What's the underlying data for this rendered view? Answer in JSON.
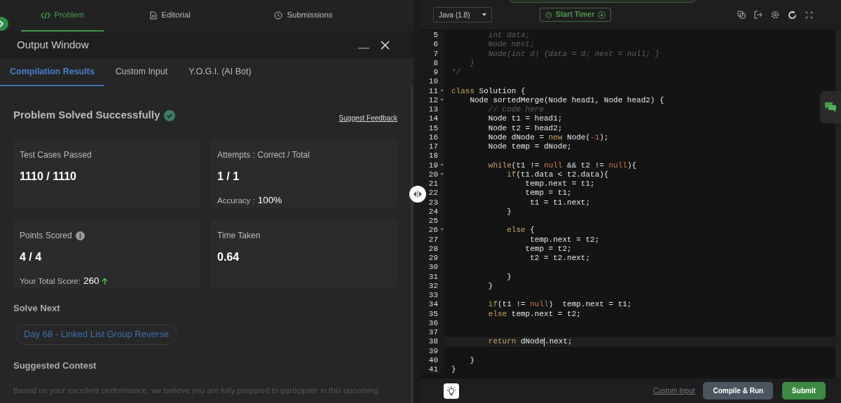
{
  "problem_tabs": [
    {
      "label": "Problem",
      "selected": true
    },
    {
      "label": "Editorial",
      "selected": false
    },
    {
      "label": "Submissions",
      "selected": false
    }
  ],
  "output_window": {
    "title": "Output Window",
    "tabs": [
      {
        "label": "Compilation Results",
        "selected": true
      },
      {
        "label": "Custom Input",
        "selected": false
      },
      {
        "label": "Y.O.G.I. (AI Bot)",
        "selected": false
      }
    ],
    "status": "Problem Solved Successfully",
    "feedback_link": "Suggest Feedback",
    "cards": [
      {
        "label": "Test Cases Passed",
        "value": "1110 / 1110"
      },
      {
        "label": "Attempts : Correct / Total",
        "value": "1 / 1",
        "note_label": "Accuracy :",
        "note_value": "100%"
      },
      {
        "label": "Points Scored",
        "info": true,
        "value": "4 / 4",
        "note_label": "Your Total Score:",
        "note_value": "260",
        "rising": true
      },
      {
        "label": "Time Taken",
        "value": "0.64"
      }
    ],
    "solve_next_heading": "Solve Next",
    "solve_next": "Day 68 - Linked List Group Reverse",
    "contest_heading": "Suggested Contest",
    "contest_text": "Based on your excellent performance, we believe you are fully prepared to participate in this upcoming"
  },
  "editor": {
    "language": "Java (1.8)",
    "timer_button": "Start Timer",
    "lines": [
      {
        "number": "5",
        "tokens": [
          {
            "kind": "comment",
            "text": "        int data;"
          }
        ]
      },
      {
        "number": "6",
        "tokens": [
          {
            "kind": "comment",
            "text": "        Node next;"
          }
        ]
      },
      {
        "number": "7",
        "tokens": [
          {
            "kind": "comment",
            "text": "        Node(int d) {data = d; next = null; }"
          }
        ]
      },
      {
        "number": "8",
        "tokens": [
          {
            "kind": "comment",
            "text": "    }"
          }
        ]
      },
      {
        "number": "9",
        "tokens": [
          {
            "kind": "comment",
            "text": "*/"
          }
        ]
      },
      {
        "number": "10"
      },
      {
        "number": "11",
        "fold": true,
        "tokens": [
          {
            "kind": "keyword",
            "text": "class"
          },
          {
            "kind": "plain",
            "text": " Solution {"
          }
        ]
      },
      {
        "number": "12",
        "fold": true,
        "tokens": [
          {
            "kind": "plain",
            "text": "    Node sortedMerge(Node head1, Node head2) {"
          }
        ]
      },
      {
        "number": "13",
        "tokens": [
          {
            "kind": "comment",
            "text": "        // code here"
          }
        ]
      },
      {
        "number": "14",
        "tokens": [
          {
            "kind": "plain",
            "text": "        Node t1 = head1;"
          }
        ]
      },
      {
        "number": "15",
        "tokens": [
          {
            "kind": "plain",
            "text": "        Node t2 = head2;"
          }
        ]
      },
      {
        "number": "16",
        "tokens": [
          {
            "kind": "plain",
            "text": "        Node dNode = "
          },
          {
            "kind": "keyword",
            "text": "new"
          },
          {
            "kind": "plain",
            "text": " Node("
          },
          {
            "kind": "literal",
            "text": "-1"
          },
          {
            "kind": "plain",
            "text": ");"
          }
        ]
      },
      {
        "number": "17",
        "tokens": [
          {
            "kind": "plain",
            "text": "        Node temp = dNode;"
          }
        ]
      },
      {
        "number": "18"
      },
      {
        "number": "19",
        "fold": true,
        "tokens": [
          {
            "kind": "keyword",
            "text": "        while"
          },
          {
            "kind": "plain",
            "text": "(t1 != "
          },
          {
            "kind": "literal",
            "text": "null"
          },
          {
            "kind": "plain",
            "text": " && t2 != "
          },
          {
            "kind": "literal",
            "text": "null"
          },
          {
            "kind": "plain",
            "text": "){"
          }
        ]
      },
      {
        "number": "20",
        "fold": true,
        "tokens": [
          {
            "kind": "keyword",
            "text": "            if"
          },
          {
            "kind": "plain",
            "text": "(t1.data < t2.data){"
          }
        ]
      },
      {
        "number": "21",
        "tokens": [
          {
            "kind": "plain",
            "text": "                temp.next = t1;"
          }
        ]
      },
      {
        "number": "22",
        "tokens": [
          {
            "kind": "plain",
            "text": "                temp = t1;"
          }
        ]
      },
      {
        "number": "23",
        "tokens": [
          {
            "kind": "plain",
            "text": "                 t1 = t1.next;"
          }
        ]
      },
      {
        "number": "24",
        "tokens": [
          {
            "kind": "plain",
            "text": "            }"
          }
        ]
      },
      {
        "number": "25"
      },
      {
        "number": "26",
        "fold": true,
        "tokens": [
          {
            "kind": "keyword",
            "text": "            else"
          },
          {
            "kind": "plain",
            "text": " {"
          }
        ]
      },
      {
        "number": "27",
        "tokens": [
          {
            "kind": "plain",
            "text": "                 temp.next = t2;"
          }
        ]
      },
      {
        "number": "28",
        "tokens": [
          {
            "kind": "plain",
            "text": "                temp = t2;"
          }
        ]
      },
      {
        "number": "29",
        "tokens": [
          {
            "kind": "plain",
            "text": "                 t2 = t2.next;"
          }
        ]
      },
      {
        "number": "30"
      },
      {
        "number": "31",
        "tokens": [
          {
            "kind": "plain",
            "text": "            }"
          }
        ]
      },
      {
        "number": "32",
        "tokens": [
          {
            "kind": "plain",
            "text": "        }"
          }
        ]
      },
      {
        "number": "33"
      },
      {
        "number": "34",
        "tokens": [
          {
            "kind": "keyword",
            "text": "        if"
          },
          {
            "kind": "plain",
            "text": "(t1 != "
          },
          {
            "kind": "literal",
            "text": "null"
          },
          {
            "kind": "plain",
            "text": ")  temp.next = t1;"
          }
        ]
      },
      {
        "number": "35",
        "tokens": [
          {
            "kind": "keyword",
            "text": "        else"
          },
          {
            "kind": "plain",
            "text": " temp.next = t2;"
          }
        ]
      },
      {
        "number": "36"
      },
      {
        "number": "37"
      },
      {
        "number": "38",
        "current": true,
        "tokens": [
          {
            "kind": "keyword",
            "text": "        return"
          },
          {
            "kind": "plain",
            "text": " dNode",
            "cursor": true
          },
          {
            "kind": "plain",
            "text": ".next;"
          }
        ]
      },
      {
        "number": "39"
      },
      {
        "number": "40",
        "tokens": [
          {
            "kind": "plain",
            "text": "    }"
          }
        ]
      },
      {
        "number": "41",
        "tokens": [
          {
            "kind": "plain",
            "text": "}"
          }
        ]
      }
    ],
    "custom_input_link": "Custom Input",
    "run_button": "Compile & Run",
    "submit_button": "Submit"
  }
}
